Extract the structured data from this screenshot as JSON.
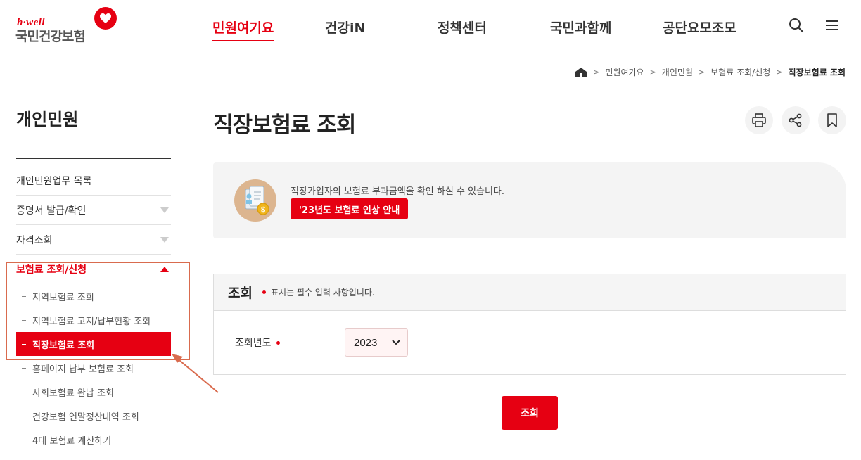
{
  "logo": {
    "top_text": "h·well",
    "main_text": "국민건강보험"
  },
  "nav": {
    "items": [
      {
        "label": "민원여기요",
        "active": true
      },
      {
        "label": "건강iN",
        "active": false
      },
      {
        "label": "정책센터",
        "active": false
      },
      {
        "label": "국민과함께",
        "active": false
      },
      {
        "label": "공단요모조모",
        "active": false
      }
    ],
    "icons": [
      "search-icon",
      "menu-icon"
    ]
  },
  "breadcrumb": {
    "items": [
      "민원여기요",
      "개인민원",
      "보험료 조회/신청"
    ],
    "current": "직장보험료 조회"
  },
  "sidebar": {
    "title": "개인민원",
    "items": [
      {
        "label": "개인민원업무 목록"
      },
      {
        "label": "증명서 발급/확인"
      },
      {
        "label": "자격조회"
      },
      {
        "label": "보험료 조회/신청"
      }
    ],
    "sub_items": [
      "지역보험료 조회",
      "지역보험료 고지/납부현황 조회",
      "직장보험료 조회",
      "홈페이지 납부 보험료 조회",
      "사회보험료 완납 조회",
      "건강보험 연말정산내역 조회",
      "4대 보험료 계산하기"
    ]
  },
  "page": {
    "title": "직장보험료 조회"
  },
  "tools": [
    "print-icon",
    "share-icon",
    "bookmark-icon"
  ],
  "info": {
    "text": "직장가입자의 보험료 부과금액을 확인 하실 수 있습니다.",
    "button": "'23년도 보험료 인상 안내"
  },
  "form": {
    "title": "조회",
    "note": "표시는 필수 입력 사항입니다.",
    "year_label": "조회년도",
    "year_value": "2023"
  },
  "submit": {
    "label": "조회"
  },
  "colors": {
    "accent": "#e60012",
    "highlight": "#d96b4e"
  }
}
